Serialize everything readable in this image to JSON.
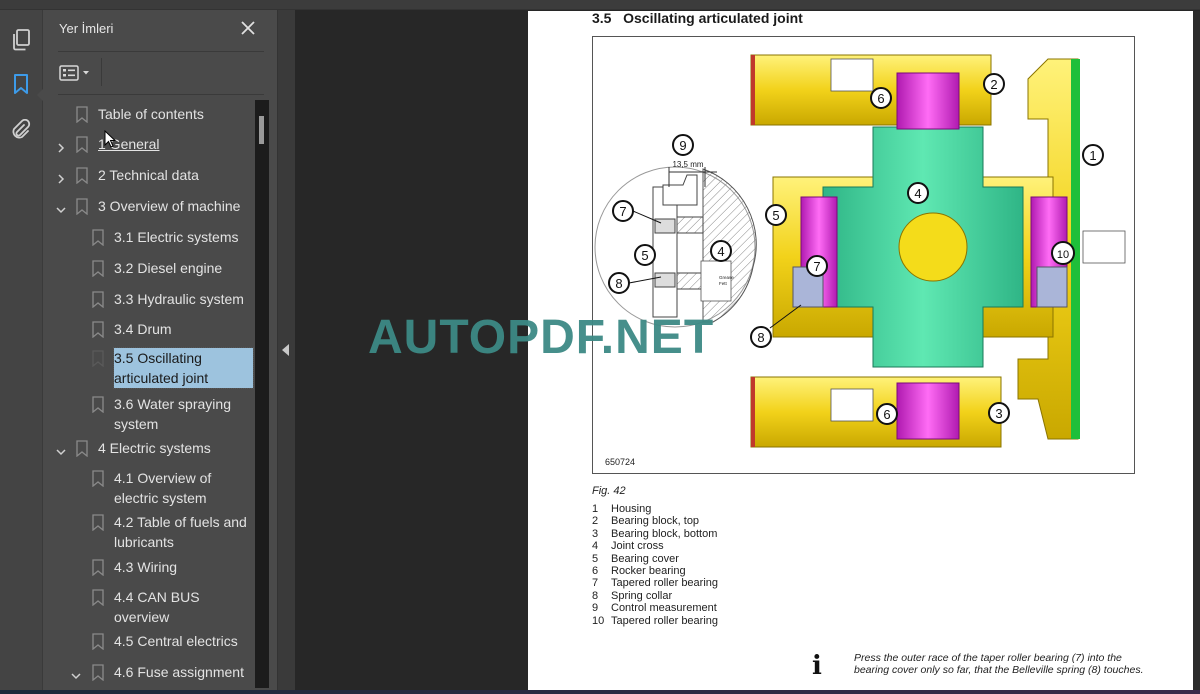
{
  "sidebar_rail": {
    "icons": [
      "pages-icon",
      "bookmark-icon",
      "attachment-icon"
    ],
    "active": "bookmark-icon",
    "accent": "#3d9be9"
  },
  "bookmarks_panel": {
    "title": "Yer İmleri",
    "items": [
      {
        "label": "Table of contents",
        "level": 0,
        "expander": "none"
      },
      {
        "label": "1 General",
        "level": 0,
        "expander": "collapsed",
        "hovered": true
      },
      {
        "label": "2 Technical data",
        "level": 0,
        "expander": "collapsed"
      },
      {
        "label": "3 Overview of machine",
        "level": 0,
        "expander": "expanded"
      },
      {
        "label": "3.1 Electric systems",
        "level": 1,
        "expander": "none"
      },
      {
        "label": "3.2 Diesel engine",
        "level": 1,
        "expander": "none"
      },
      {
        "label": "3.3 Hydraulic system",
        "level": 1,
        "expander": "none"
      },
      {
        "label": "3.4 Drum",
        "level": 1,
        "expander": "none"
      },
      {
        "label": "3.5 Oscillating articulated joint",
        "level": 1,
        "expander": "none",
        "selected": true
      },
      {
        "label": "3.6 Water spraying system",
        "level": 1,
        "expander": "none"
      },
      {
        "label": "4 Electric systems",
        "level": 0,
        "expander": "expanded"
      },
      {
        "label": "4.1 Overview of electric system",
        "level": 1,
        "expander": "none"
      },
      {
        "label": "4.2 Table of fuels and lubricants",
        "level": 1,
        "expander": "none"
      },
      {
        "label": "4.3 Wiring",
        "level": 1,
        "expander": "none"
      },
      {
        "label": "4.4 CAN BUS overview",
        "level": 1,
        "expander": "none"
      },
      {
        "label": "4.5 Central electrics",
        "level": 1,
        "expander": "none"
      },
      {
        "label": "4.6 Fuse assignment",
        "level": 1,
        "expander": "expanded"
      }
    ]
  },
  "document": {
    "heading": "3.5   Oscillating articulated joint",
    "figure": {
      "id": "650724",
      "caption": "Fig.  42",
      "dimension_label": "13,5 mm",
      "grease_label": [
        "Grease",
        "Fett",
        "Graisse",
        "Grasa"
      ],
      "callouts": [
        "1",
        "2",
        "3",
        "4",
        "5",
        "6",
        "7",
        "8",
        "9",
        "10"
      ]
    },
    "legend": [
      {
        "n": "1",
        "text": "Housing"
      },
      {
        "n": "2",
        "text": "Bearing block, top"
      },
      {
        "n": "3",
        "text": "Bearing block, bottom"
      },
      {
        "n": "4",
        "text": "Joint cross"
      },
      {
        "n": "5",
        "text": "Bearing cover"
      },
      {
        "n": "6",
        "text": "Rocker bearing"
      },
      {
        "n": "7",
        "text": "Tapered roller bearing"
      },
      {
        "n": "8",
        "text": "Spring collar"
      },
      {
        "n": "9",
        "text": "Control measurement"
      },
      {
        "n": "10",
        "text": "Tapered roller bearing"
      }
    ],
    "note": {
      "icon": "info-icon",
      "text": "Press the outer race of the taper roller bearing (7) into the bearing cover only so far, that the Belleville spring (8) touches."
    }
  },
  "watermark": "AUTOPDF.NET",
  "colors": {
    "housing_yellow": "#f2d21a",
    "joint_cross_green": "#3fd49a",
    "bearing_magenta": "#e030d8",
    "selection": "#9dc3de",
    "watermark": "#3d8a85"
  }
}
